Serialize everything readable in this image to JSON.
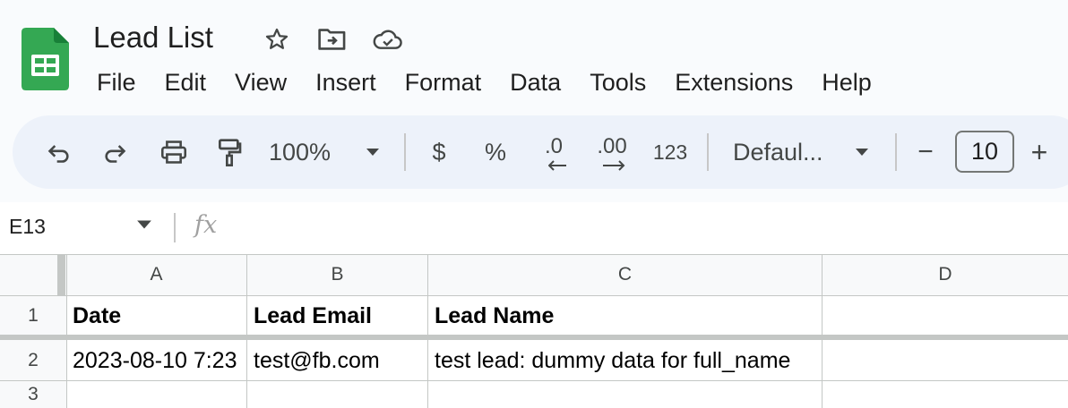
{
  "doc": {
    "title": "Lead List"
  },
  "menu": [
    "File",
    "Edit",
    "View",
    "Insert",
    "Format",
    "Data",
    "Tools",
    "Extensions",
    "Help"
  ],
  "toolbar": {
    "zoom": "100%",
    "currency": "$",
    "percent": "%",
    "decrease_decimal": ".0",
    "increase_decimal": ".00",
    "number_format": "123",
    "font": "Defaul...",
    "font_size": "10",
    "minus": "−",
    "plus": "+"
  },
  "formula_bar": {
    "cell_ref": "E13",
    "fx": "fx"
  },
  "columns": [
    "A",
    "B",
    "C",
    "D"
  ],
  "rows": [
    "1",
    "2",
    "3"
  ],
  "cells": {
    "a1": "Date",
    "b1": "Lead Email",
    "c1": "Lead Name",
    "a2": "2023-08-10 7:23",
    "b2": "test@fb.com",
    "c2": "test lead: dummy data for full_name"
  },
  "colors": {
    "accent": "#0f9d58",
    "toolbar_bg": "#edf2fa",
    "page_bg": "#f9fbfd"
  }
}
